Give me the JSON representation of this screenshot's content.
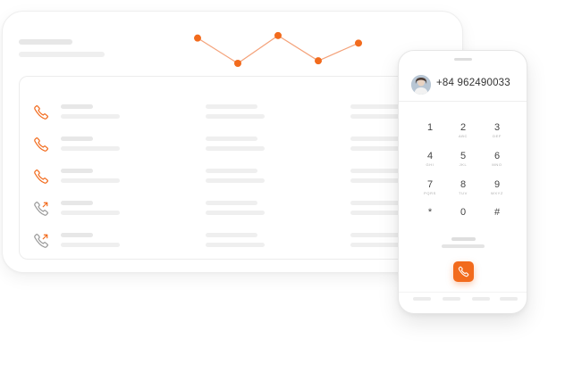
{
  "theme": {
    "accent": "#f26b1d",
    "placeholder": "#e7e7e7"
  },
  "trend": {
    "points": [
      10,
      60,
      5,
      55,
      20
    ]
  },
  "call_list": {
    "rows": [
      {
        "direction": "incoming",
        "icon": "phone-icon"
      },
      {
        "direction": "incoming",
        "icon": "phone-icon"
      },
      {
        "direction": "incoming",
        "icon": "phone-icon"
      },
      {
        "direction": "outgoing",
        "icon": "phone-outgoing-icon"
      },
      {
        "direction": "outgoing",
        "icon": "phone-outgoing-icon"
      }
    ]
  },
  "dialer": {
    "phone_number": "+84 962490033",
    "keys": [
      {
        "digit": "1",
        "letters": ""
      },
      {
        "digit": "2",
        "letters": "ABC"
      },
      {
        "digit": "3",
        "letters": "DEF"
      },
      {
        "digit": "4",
        "letters": "GHI"
      },
      {
        "digit": "5",
        "letters": "JKL"
      },
      {
        "digit": "6",
        "letters": "MNO"
      },
      {
        "digit": "7",
        "letters": "PQRS"
      },
      {
        "digit": "8",
        "letters": "TUV"
      },
      {
        "digit": "9",
        "letters": "WXYZ"
      },
      {
        "digit": "*",
        "letters": ""
      },
      {
        "digit": "0",
        "letters": ""
      },
      {
        "digit": "#",
        "letters": ""
      }
    ],
    "call_button_icon": "phone-icon"
  }
}
